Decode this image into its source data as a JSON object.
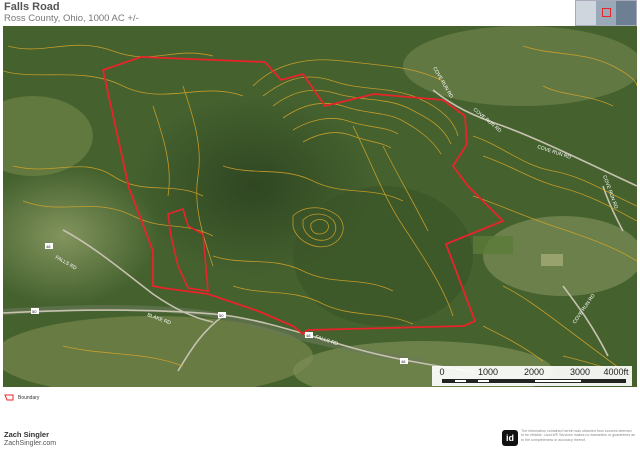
{
  "header": {
    "title": "Falls Road",
    "subtitle": "Ross County, Ohio, 1000 AC +/-"
  },
  "map": {
    "type": "aerial-satellite",
    "boundary_color": "#e8242a",
    "contour_color": "#d9a62a",
    "road_labels": [
      {
        "id": "falls-rd-w",
        "text": "FALLS RD"
      },
      {
        "id": "blake-rd",
        "text": "BLAKE RD"
      },
      {
        "id": "falls-rd-s",
        "text": "FALLS RD"
      },
      {
        "id": "cove-run-rd",
        "text": "COVE RUN RD"
      },
      {
        "id": "cove-run-rd-2",
        "text": "COVE RUN RD"
      },
      {
        "id": "cove-run-rd-3",
        "text": "COVE RUN RD"
      },
      {
        "id": "cove-run-rd-4",
        "text": "COVE RUN RD"
      },
      {
        "id": "cove-run-rd-5",
        "text": "COVE RUN RD"
      }
    ],
    "route_shields": [
      "48",
      "50",
      "50",
      "48",
      "48"
    ]
  },
  "scale_bar": {
    "labels": [
      "0",
      "1000",
      "2000",
      "3000",
      "4000ft"
    ]
  },
  "legend": {
    "items": [
      {
        "label": "Boundary",
        "color": "#e8242a"
      }
    ]
  },
  "agent": {
    "name": "Zach Singler",
    "website": "ZachSingler.com"
  },
  "brand": {
    "logo_text": "id"
  },
  "disclaimer": "The information contained herein was obtained from sources deemed to be reliable. Land id® Services makes no warranties or guarantees as to the completeness or accuracy thereof."
}
